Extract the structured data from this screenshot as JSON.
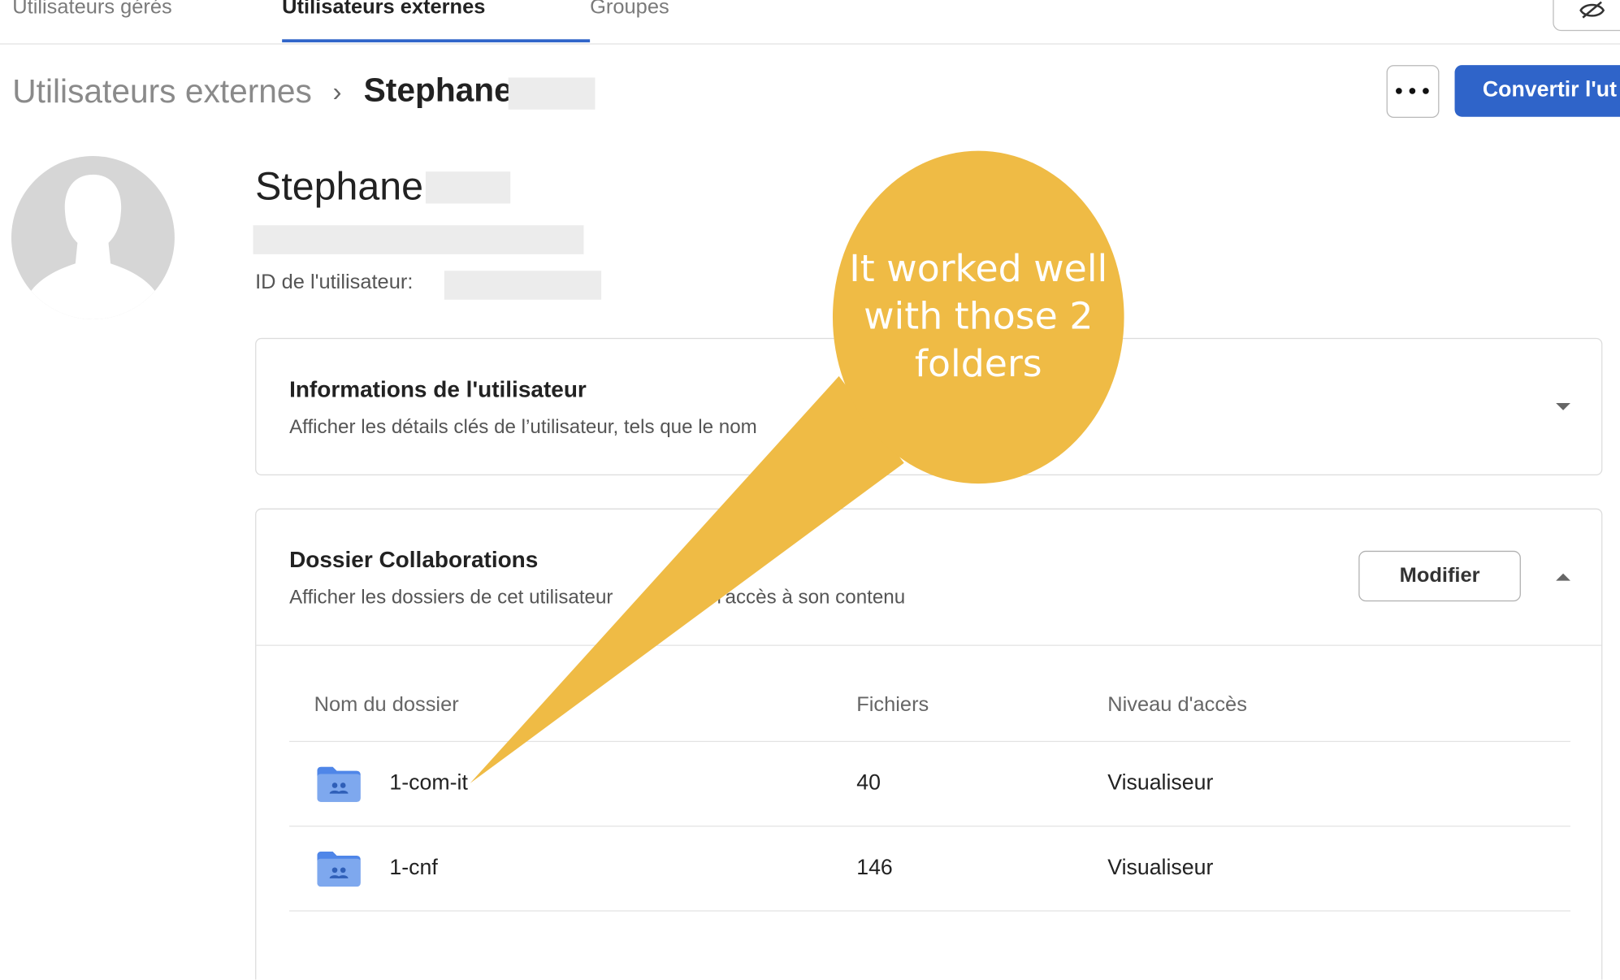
{
  "tabs": [
    {
      "label": "Utilisateurs gérés"
    },
    {
      "label": "Utilisateurs externes"
    },
    {
      "label": "Groupes"
    }
  ],
  "breadcrumb": {
    "root": "Utilisateurs externes",
    "separator": "›",
    "current": "Stephane"
  },
  "header_actions": {
    "more_icon": "ellipsis-icon",
    "convert_label": "Convertir l'ut"
  },
  "profile": {
    "name": "Stephane",
    "user_id_label": "ID de l'utilisateur:"
  },
  "user_info_card": {
    "title": "Informations de l'utilisateur",
    "description": "Afficher les détails clés de l’utilisateur, tels que le nom"
  },
  "collab_card": {
    "title": "Dossier Collaborations",
    "description_part1": "Afficher les dossiers de cet utilisateur",
    "description_part2": "l'accès à son contenu",
    "modify_label": "Modifier",
    "columns": [
      "Nom du dossier",
      "Fichiers",
      "Niveau d'accès"
    ],
    "rows": [
      {
        "name": "1-com-it",
        "files": "40",
        "access": "Visualiseur"
      },
      {
        "name": "1-cnf",
        "files": "146",
        "access": "Visualiseur"
      }
    ]
  },
  "annotation": {
    "text_line1": "It worked well",
    "text_line2": "with those 2",
    "text_line3": "folders",
    "color": "#efbb45"
  },
  "colors": {
    "accent": "#2f64c9",
    "folder": "#7ea8ee"
  }
}
